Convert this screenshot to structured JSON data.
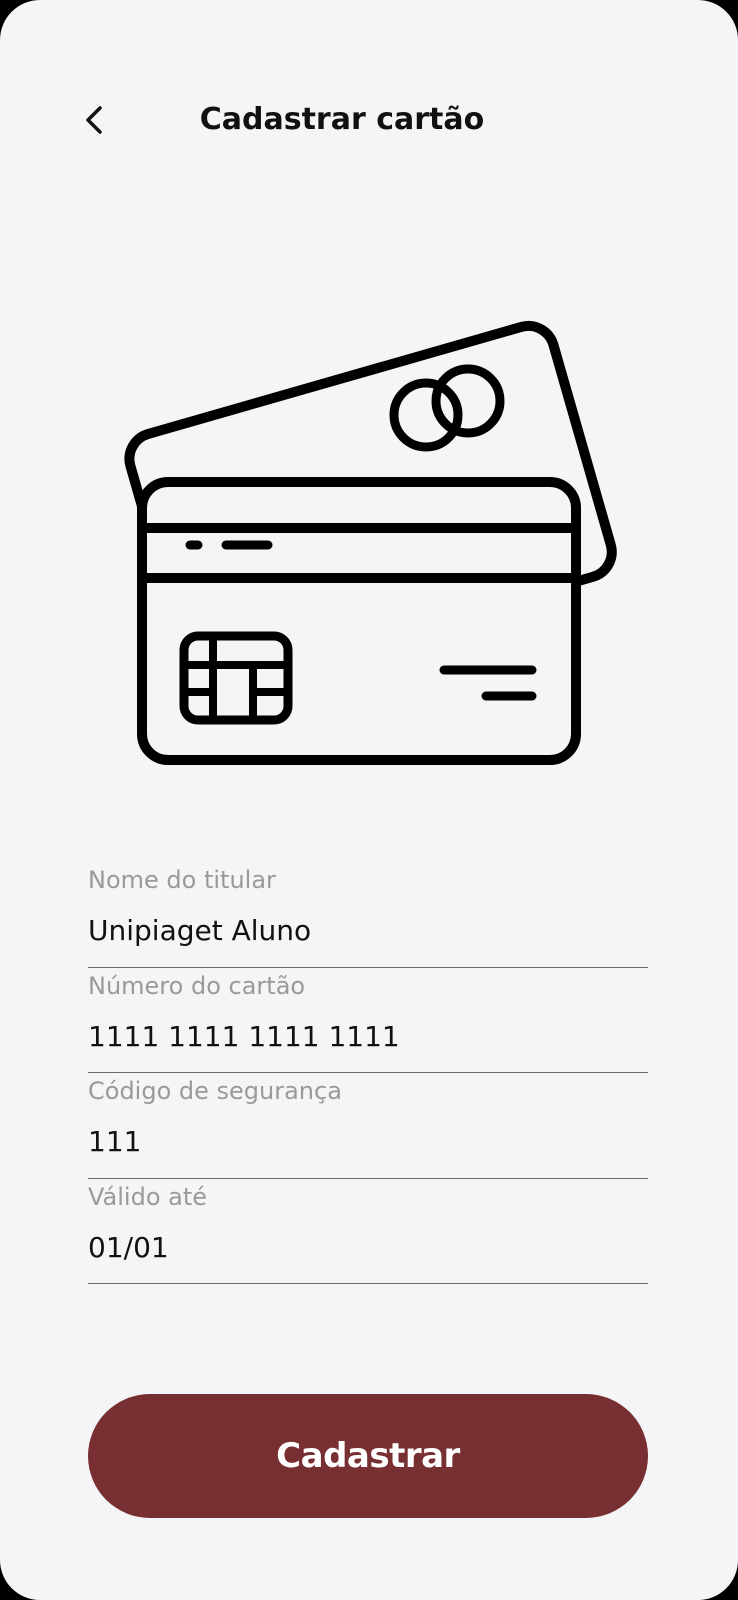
{
  "header": {
    "title": "Cadastrar cartão",
    "back_icon": "chevron-left-icon"
  },
  "illustration": {
    "icon": "credit-cards-icon"
  },
  "form": {
    "fields": [
      {
        "label": "Nome do titular",
        "value": "Unipiaget Aluno"
      },
      {
        "label": "Número do cartão",
        "value": "1111 1111 1111 1111"
      },
      {
        "label": "Código de segurança",
        "value": "111"
      },
      {
        "label": "Válido até",
        "value": "01/01"
      }
    ]
  },
  "actions": {
    "submit_label": "Cadastrar"
  },
  "colors": {
    "background": "#F5F5F8",
    "accent": "#782F32",
    "label": "#9A9A9A",
    "text": "#111111"
  }
}
